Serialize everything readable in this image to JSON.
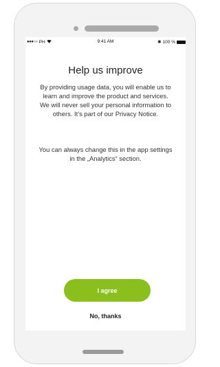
{
  "status_bar": {
    "signal": "●●●○○",
    "carrier": "PH",
    "time": "9:41 AM",
    "bluetooth": "✱",
    "battery_percent": "100 %"
  },
  "content": {
    "title": "Help us improve",
    "paragraph_1": [
      "By providing usage data, you will enable us to",
      "learn and improve the product and services.",
      "We will never sell your personal information to",
      "others. It’s part of our Privacy Notice."
    ],
    "paragraph_2_line_1": "You can always change this in the app settings",
    "paragraph_2_line_2": "in the „Analytics“ section."
  },
  "actions": {
    "agree_label": "I agree",
    "decline_label": "No, thanks"
  },
  "colors": {
    "accent": "#8bbf1e"
  }
}
